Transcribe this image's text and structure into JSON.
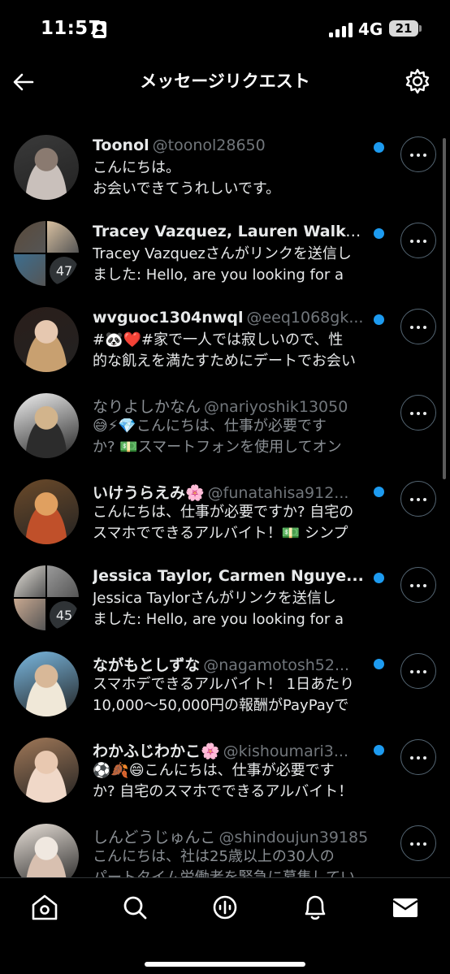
{
  "status_bar": {
    "time": "11:57",
    "network": "4G",
    "battery": "21"
  },
  "header": {
    "title": "メッセージリクエスト",
    "back_icon": "back-arrow-icon",
    "settings_icon": "gear-icon"
  },
  "colors": {
    "accent": "#1d9bf0",
    "background": "#000000",
    "text": "#e7e9ea",
    "secondary_text": "#71767b"
  },
  "messages": [
    {
      "name": "Toonol",
      "handle": "@toonol28650",
      "line1": "こんにちは。",
      "line2": "お会いできてうれしいです。",
      "unread": true,
      "avatar": "photo-avatar"
    },
    {
      "name": "Tracey Vazquez, Lauren Walke...",
      "handle": "",
      "line1": "Tracey Vazquezさんがリンクを送信し",
      "line2": "ました: Hello, are you looking for a",
      "unread": true,
      "group_count": "47",
      "avatar": "group-avatar"
    },
    {
      "name": "wvguoc1304nwql",
      "handle": "@eeq1068gk...",
      "line1": "#🐼❤️#家で一人では寂しいので、性",
      "line2": "的な飢えを満たすためにデートでお会い",
      "unread": true,
      "avatar": "photo-avatar"
    },
    {
      "name": "なりよしかなん",
      "handle": "@nariyoshik13050",
      "line1": "😅⚡💎こんにちは、仕事が必要です",
      "line2": "か? 💵スマートフォンを使用してオン",
      "unread": false,
      "avatar": "photo-avatar"
    },
    {
      "name": "いけうらえみ🌸",
      "handle": "@funatahisa912...",
      "line1": "こんにちは、仕事が必要ですか? 自宅の",
      "line2": "スマホでできるアルバイト！💵 シンプ",
      "unread": true,
      "avatar": "photo-avatar"
    },
    {
      "name": "Jessica Taylor, Carmen Nguye...",
      "handle": "",
      "line1": "Jessica Taylorさんがリンクを送信し",
      "line2": "ました: Hello, are you looking for a",
      "unread": true,
      "group_count": "45",
      "avatar": "group-avatar"
    },
    {
      "name": "ながもとしずな",
      "handle": "@nagamotosh52...",
      "line1": "スマホデできるアルバイト！ 1日あたり",
      "line2": "10,000〜50,000円の報酬がPayPayで",
      "unread": true,
      "avatar": "photo-avatar"
    },
    {
      "name": "わかふじわかこ🌸",
      "handle": "@kishoumari3...",
      "line1": "⚽🍂😄こんにちは、仕事が必要です",
      "line2": "か? 自宅のスマホでできるアルバイト！",
      "unread": true,
      "avatar": "photo-avatar"
    },
    {
      "name": "しんどうじゅんこ",
      "handle": "@shindoujun39185",
      "line1": "こんにちは、社は25歳以上の30人の",
      "line2": "パートタイム労働者を緊急に募集してい",
      "unread": false,
      "avatar": "photo-avatar"
    }
  ],
  "tab_bar": {
    "home_icon": "home-icon",
    "search_icon": "search-icon",
    "spaces_icon": "spaces-icon",
    "notifications_icon": "bell-icon",
    "messages_icon": "mail-icon"
  }
}
